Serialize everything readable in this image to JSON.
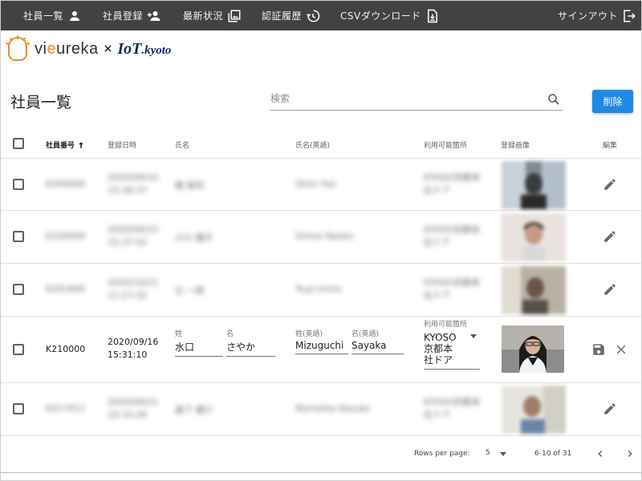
{
  "nav": {
    "employee_list": "社員一覧",
    "employee_register": "社員登録",
    "latest_status": "最新状況",
    "auth_history": "認証履歴",
    "csv_download": "CSVダウンロード",
    "sign_out": "サインアウト"
  },
  "logo": {
    "vieureka_pre": "vi",
    "vieureka_e": "e",
    "vieureka_post": "ureka",
    "times": "×",
    "iot": "IoT",
    "kyoto": ".kyoto"
  },
  "header": {
    "title": "社員一覧",
    "search_placeholder": "検索",
    "delete_label": "削除"
  },
  "columns": {
    "employee_no": "社員番号",
    "registered_at": "登録日時",
    "name": "氏名",
    "name_en": "氏名(英語)",
    "locations": "利用可能箇所",
    "photo": "登録画像",
    "edit": "編集"
  },
  "rows": [
    {
      "employee_no": "K200000",
      "date": "2020/09/10",
      "time": "15:28:37",
      "name": "橋 保司",
      "name_en": "Shiro Yuji",
      "loc1": "KYOSO京都本",
      "loc2": "社ドア"
    },
    {
      "employee_no": "K220000",
      "date": "2020/09/15",
      "time": "15:37:55",
      "name": "小川 優子",
      "name_en": "Simon Naoko",
      "loc1": "KYOSO京都本",
      "loc2": "社ドア"
    },
    {
      "employee_no": "K201900",
      "date": "2020/10/21",
      "time": "11:27:32",
      "name": "辻 一郎",
      "name_en": "Tsuji Ichiro",
      "loc1": "KYOSO京都本",
      "loc2": "社ドア"
    },
    {
      "employee_no": "K217011",
      "date": "2020/09/21",
      "time": "10:33:26",
      "name": "森下 康介",
      "name_en": "Morishita Kosuke",
      "loc1": "KYOSO京都本",
      "loc2": "社ドア"
    }
  ],
  "editing_row": {
    "employee_no": "K210000",
    "date": "2020/09/16",
    "time": "15:31:10",
    "last_name_label": "姓",
    "last_name": "水口",
    "first_name_label": "名",
    "first_name": "さやか",
    "last_name_en_label": "姓(英語)",
    "last_name_en": "Mizuguchi",
    "first_name_en_label": "名(英語)",
    "first_name_en": "Sayaka",
    "location_label": "利用可能箇所",
    "location_line1": "KYOSO",
    "location_line2": "京都本",
    "location_line3": "社ドア"
  },
  "pagination": {
    "rows_per_page_label": "Rows per page:",
    "rows_per_page": "5",
    "range": "6-10 of 31"
  },
  "colors": {
    "topbar": "#424242",
    "accent": "#1e88e5",
    "brand_orange": "#f08a24",
    "brand_navy": "#0f2a63"
  }
}
